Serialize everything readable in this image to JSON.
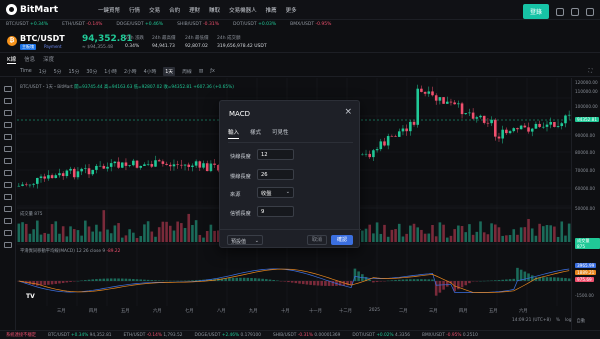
{
  "nav": {
    "logo": "BitMart",
    "items": [
      "一鍵買幣",
      "行情",
      "交易",
      "合約",
      "理財",
      "賺取",
      "交易機器人",
      "推薦",
      "更多"
    ],
    "login_label": "登錄"
  },
  "ticker": [
    {
      "pair": "BTC/USDT",
      "change": "+0.34%",
      "dir": "pos"
    },
    {
      "pair": "ETH/USDT",
      "change": "-0.14%",
      "dir": "neg"
    },
    {
      "pair": "DOGE/USDT",
      "change": "+0.46%",
      "dir": "pos"
    },
    {
      "pair": "SHIB/USDT",
      "change": "-0.31%",
      "dir": "neg"
    },
    {
      "pair": "DOT/USDT",
      "change": "+0.03%",
      "dir": "pos"
    },
    {
      "pair": "BMX/USDT",
      "change": "-0.95%",
      "dir": "neg"
    }
  ],
  "header": {
    "coin_symbol": "₿",
    "pair": "BTC/USDT",
    "badge_spot": "主板塊",
    "badge_payment": "Payment",
    "price": "94,352.81",
    "sub_price": "≈ $94,355.48",
    "stats": [
      {
        "label": "24h 漲跌",
        "value": "0.34%"
      },
      {
        "label": "24h 最高價",
        "value": "94,941.73"
      },
      {
        "label": "24h 最低價",
        "value": "92,807.02"
      },
      {
        "label": "24h 成交額",
        "value": "319,656,978.42 USDT"
      }
    ]
  },
  "tabs": [
    "K線",
    "信息",
    "深度"
  ],
  "toolbar": {
    "items": [
      "Time",
      "1分",
      "5分",
      "15分",
      "30分",
      "1小時",
      "2小時",
      "4小時",
      "1天",
      "周線"
    ],
    "active": "1天"
  },
  "chart": {
    "legend_main": "BTC/USDT・1天・BitMart",
    "legend_ohlc": "開=93745.44 高=94163.63 低=92807.02 收=94352.81 +607.36 (+0.65%)",
    "legend_volume": "成交量 875",
    "legend_macd": "平滑異同移動平均線(MACD) 12 26 close 9",
    "macd_value": "-89.22",
    "watermark": "TV"
  },
  "price_axis": [
    "120000.00",
    "110000.00",
    "100000.00",
    "94352.81",
    "90000.00",
    "80000.00",
    "70000.00",
    "60000.00",
    "50000.00"
  ],
  "price_tag": "94352.81",
  "macd_axis": [
    "3965.99",
    "1889.21",
    "975.69",
    "-1500.00"
  ],
  "time_axis": [
    "三月",
    "四月",
    "五月",
    "六月",
    "七月",
    "八月",
    "九月",
    "十月",
    "十一月",
    "十二月",
    "2025",
    "二月",
    "三月",
    "四月",
    "五月",
    "六月"
  ],
  "footer": {
    "status": "系統連接不穩定",
    "tickers": [
      {
        "pair": "BTC/USDT",
        "change": "+0.34%",
        "price": "94,352.81",
        "dir": "pos"
      },
      {
        "pair": "ETH/USDT",
        "change": "-0.14%",
        "price": "1,793.52",
        "dir": "neg"
      },
      {
        "pair": "DOGE/USDT",
        "change": "+2.46%",
        "price": "0.179100",
        "dir": "pos"
      },
      {
        "pair": "SHIB/USDT",
        "change": "-0.31%",
        "price": "0.00001369",
        "dir": "neg"
      },
      {
        "pair": "DOT/USDT",
        "change": "+0.02%",
        "price": "4.3356",
        "dir": "pos"
      },
      {
        "pair": "BMX/USDT",
        "change": "-0.95%",
        "price": "0.2510",
        "dir": "neg"
      }
    ],
    "time": "14:09:21 (UTC+8)",
    "scale_pct": "%",
    "scale_log": "log",
    "scale_auto": "自動"
  },
  "modal": {
    "title": "MACD",
    "close": "×",
    "tabs": [
      "輸入",
      "樣式",
      "可見性"
    ],
    "active_tab": "輸入",
    "fields": [
      {
        "label": "快線長度",
        "value": "12"
      },
      {
        "label": "慢線長度",
        "value": "26"
      },
      {
        "label": "來源",
        "value": "收盤"
      },
      {
        "label": "信號長度",
        "value": "9"
      }
    ],
    "preset": "預設值",
    "cancel": "取消",
    "ok": "確認"
  }
}
